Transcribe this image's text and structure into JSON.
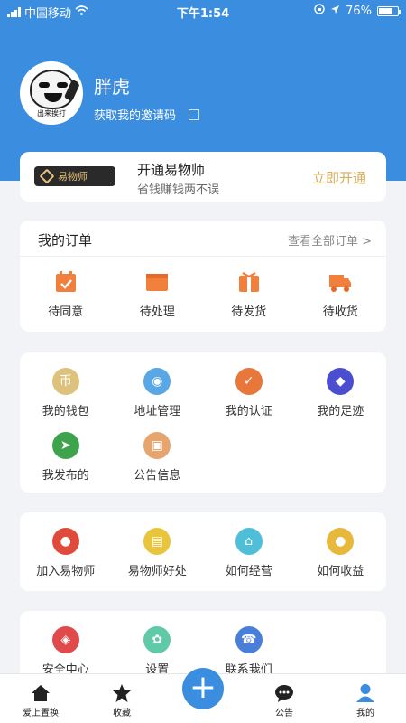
{
  "status_bar": {
    "carrier": "中国移动",
    "time": "下午1:54",
    "battery": "76%",
    "battery_level": 0.76
  },
  "profile": {
    "avatar_caption": "出来挨打",
    "username": "胖虎",
    "invite_label": "获取我的邀请码"
  },
  "vip": {
    "badge": "易物师",
    "title": "开通易物师",
    "subtitle": "省钱赚钱两不误",
    "cta": "立即开通"
  },
  "orders": {
    "title": "我的订单",
    "view_all": "查看全部订单 >",
    "items": [
      {
        "label": "待同意",
        "icon": "calendar-check-icon",
        "color": "#f0803c"
      },
      {
        "label": "待处理",
        "icon": "folder-icon",
        "color": "#f0803c"
      },
      {
        "label": "待发货",
        "icon": "gift-box-icon",
        "color": "#f0803c"
      },
      {
        "label": "待收货",
        "icon": "truck-icon",
        "color": "#f0803c"
      }
    ]
  },
  "services": [
    {
      "label": "我的钱包",
      "icon": "coin-icon",
      "color": "#dcc27a",
      "glyph": "币"
    },
    {
      "label": "地址管理",
      "icon": "location-pin-icon",
      "color": "#5aa7e6",
      "glyph": "◉"
    },
    {
      "label": "我的认证",
      "icon": "shield-check-icon",
      "color": "#e8773c",
      "glyph": "✓"
    },
    {
      "label": "我的足迹",
      "icon": "footprint-icon",
      "color": "#4b4fcf",
      "glyph": "◆"
    },
    {
      "label": "我发布的",
      "icon": "paper-plane-icon",
      "color": "#3fa34d",
      "glyph": "➤"
    },
    {
      "label": "公告信息",
      "icon": "notice-icon",
      "color": "#e6a46e",
      "glyph": "▣"
    }
  ],
  "vip_links": [
    {
      "label": "加入易物师",
      "icon": "group-icon",
      "color": "#e04a3a",
      "glyph": "●"
    },
    {
      "label": "易物师好处",
      "icon": "wallet-icon",
      "color": "#e8c53c",
      "glyph": "▤"
    },
    {
      "label": "如何经营",
      "icon": "store-icon",
      "color": "#4fbfd9",
      "glyph": "⌂"
    },
    {
      "label": "如何收益",
      "icon": "piggy-bank-icon",
      "color": "#e8b83c",
      "glyph": "●"
    }
  ],
  "settings": [
    {
      "label": "安全中心",
      "icon": "security-icon",
      "color": "#e04a4a",
      "glyph": "◈"
    },
    {
      "label": "设置",
      "icon": "gear-icon",
      "color": "#5fc9a8",
      "glyph": "✿"
    },
    {
      "label": "联系我们",
      "icon": "headset-icon",
      "color": "#4a7fd9",
      "glyph": "☎"
    }
  ],
  "tabbar": {
    "items": [
      {
        "label": "爱上置换",
        "icon": "home-icon"
      },
      {
        "label": "收藏",
        "icon": "star-icon"
      },
      {
        "label": "公告",
        "icon": "chat-icon"
      },
      {
        "label": "我的",
        "icon": "person-icon",
        "active": true
      }
    ],
    "fab": "+",
    "accent": "#3b8de0"
  }
}
